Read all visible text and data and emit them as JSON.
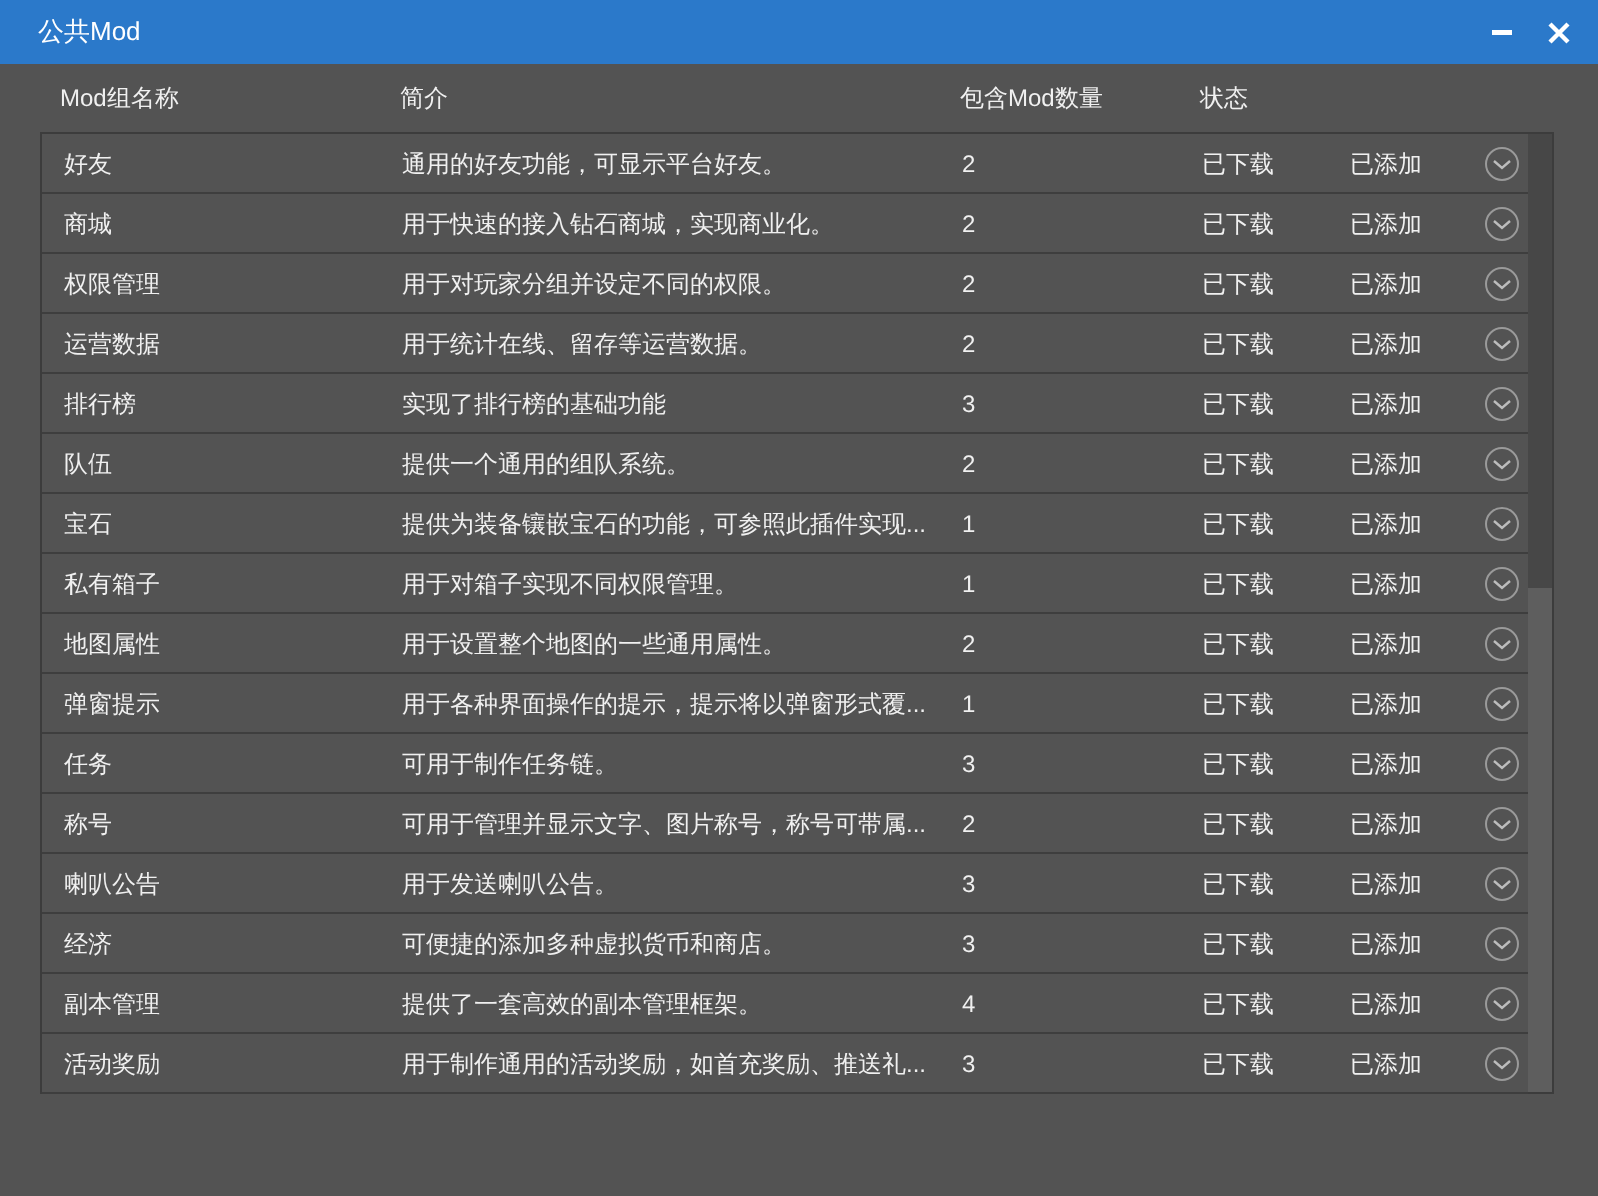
{
  "window": {
    "title": "公共Mod"
  },
  "table": {
    "columns": [
      "Mod组名称",
      "简介",
      "包含Mod数量",
      "状态"
    ],
    "rows": [
      {
        "name": "好友",
        "description": "通用的好友功能，可显示平台好友。",
        "count": "2",
        "download": "已下载",
        "added": "已添加"
      },
      {
        "name": "商城",
        "description": "用于快速的接入钻石商城，实现商业化。",
        "count": "2",
        "download": "已下载",
        "added": "已添加"
      },
      {
        "name": "权限管理",
        "description": "用于对玩家分组并设定不同的权限。",
        "count": "2",
        "download": "已下载",
        "added": "已添加"
      },
      {
        "name": "运营数据",
        "description": "用于统计在线、留存等运营数据。",
        "count": "2",
        "download": "已下载",
        "added": "已添加"
      },
      {
        "name": "排行榜",
        "description": "实现了排行榜的基础功能",
        "count": "3",
        "download": "已下载",
        "added": "已添加"
      },
      {
        "name": "队伍",
        "description": "提供一个通用的组队系统。",
        "count": "2",
        "download": "已下载",
        "added": "已添加"
      },
      {
        "name": "宝石",
        "description": "提供为装备镶嵌宝石的功能，可参照此插件实现...",
        "count": "1",
        "download": "已下载",
        "added": "已添加"
      },
      {
        "name": "私有箱子",
        "description": "用于对箱子实现不同权限管理。",
        "count": "1",
        "download": "已下载",
        "added": "已添加"
      },
      {
        "name": "地图属性",
        "description": "用于设置整个地图的一些通用属性。",
        "count": "2",
        "download": "已下载",
        "added": "已添加"
      },
      {
        "name": "弹窗提示",
        "description": "用于各种界面操作的提示，提示将以弹窗形式覆...",
        "count": "1",
        "download": "已下载",
        "added": "已添加"
      },
      {
        "name": "任务",
        "description": "可用于制作任务链。",
        "count": "3",
        "download": "已下载",
        "added": "已添加"
      },
      {
        "name": "称号",
        "description": "可用于管理并显示文字、图片称号，称号可带属...",
        "count": "2",
        "download": "已下载",
        "added": "已添加"
      },
      {
        "name": "喇叭公告",
        "description": "用于发送喇叭公告。",
        "count": "3",
        "download": "已下载",
        "added": "已添加"
      },
      {
        "name": "经济",
        "description": "可便捷的添加多种虚拟货币和商店。",
        "count": "3",
        "download": "已下载",
        "added": "已添加"
      },
      {
        "name": "副本管理",
        "description": "提供了一套高效的副本管理框架。",
        "count": "4",
        "download": "已下载",
        "added": "已添加"
      },
      {
        "name": "活动奖励",
        "description": "用于制作通用的活动奖励，如首充奖励、推送礼...",
        "count": "3",
        "download": "已下载",
        "added": "已添加"
      }
    ]
  }
}
